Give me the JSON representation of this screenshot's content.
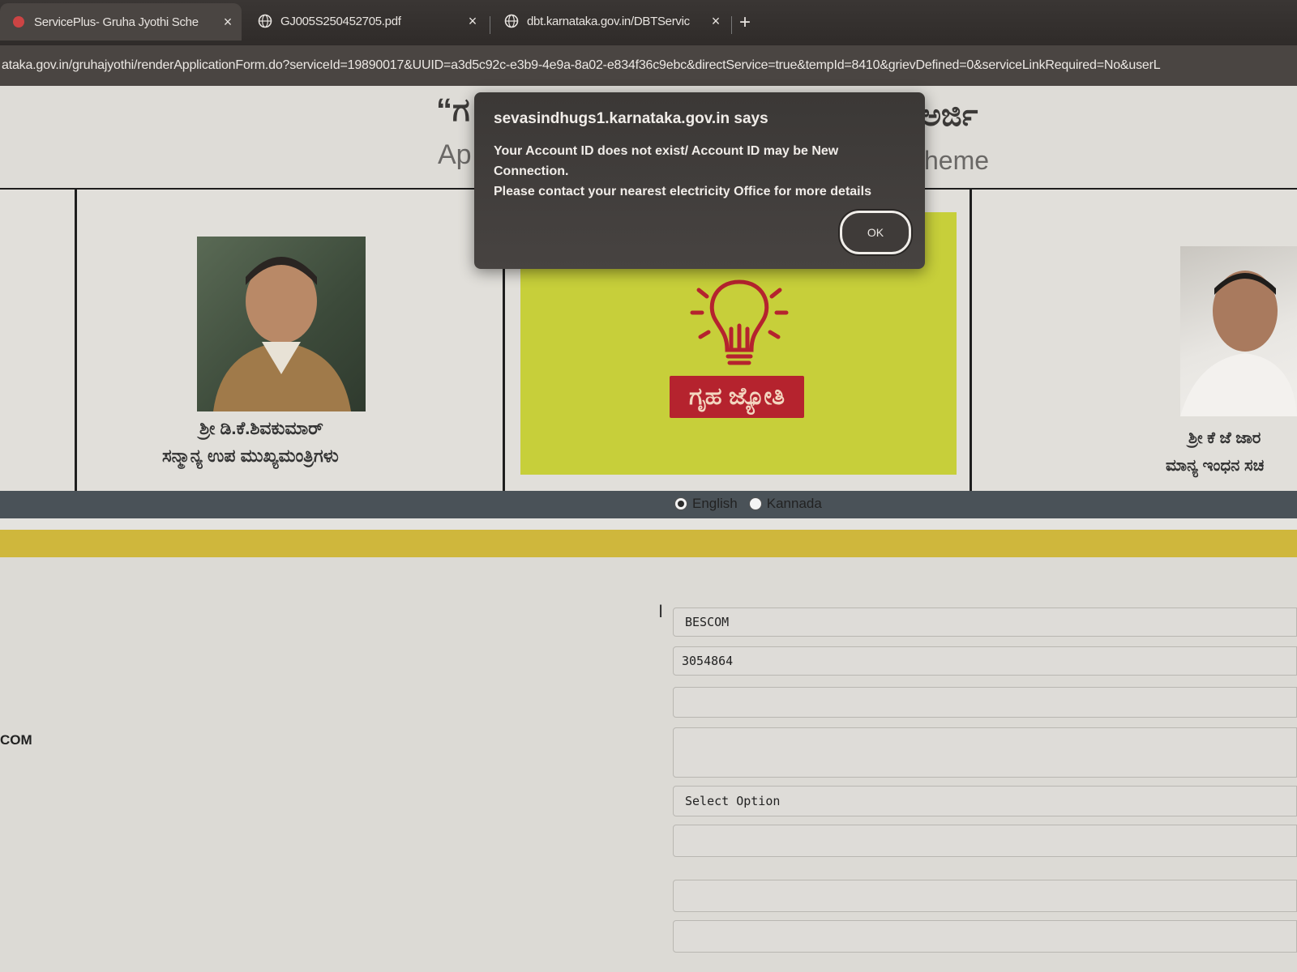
{
  "browser": {
    "tabs": [
      {
        "title": "ServicePlus- Gruha Jyothi Sche",
        "icon": "site-favicon"
      },
      {
        "title": "GJ005S250452705.pdf",
        "icon": "globe-icon"
      },
      {
        "title": "dbt.karnataka.gov.in/DBTServic",
        "icon": "globe-icon"
      }
    ],
    "close_glyph": "×",
    "new_tab_glyph": "+",
    "url": "ataka.gov.in/gruhajyothi/renderApplicationForm.do?serviceId=19890017&UUID=a3d5c92c-e3b9-4e9a-8a02-e834f36c9ebc&directService=true&tempId=8410&grievDefined=0&serviceLinkRequired=No&userL"
  },
  "header": {
    "quote_fragment": "“ಗ",
    "title_fragment_kn": "ಅರ್ಜಿ",
    "ap_fragment": "Ap",
    "scheme_fragment": "heme"
  },
  "banner": {
    "left_caption_line1": "ಶ್ರೀ ಡಿ.ಕೆ.ಶಿವಕುಮಾರ್",
    "left_caption_line2": "ಸನ್ಮಾನ್ಯ ಉಪ ಮುಖ್ಯಮಂತ್ರಿಗಳು",
    "logo_text": "ಗೃಹ ಜ್ಯೋತಿ",
    "right_caption_line1": "ಶ್ರೀ ಕೆ ಜೆ ಜಾರ",
    "right_caption_line2": "ಮಾನ್ಯ ಇಂಧನ ಸಚ"
  },
  "form": {
    "language_options": [
      "English",
      "Kannada"
    ],
    "selected_language": "English",
    "escom_value": "BESCOM",
    "account_id_value": "3054864",
    "select_placeholder": "Select Option",
    "side_label_fragment": "COM"
  },
  "dialog": {
    "origin": "sevasindhugs1.karnataka.gov.in says",
    "message_line1": "Your Account ID does not exist/ Account ID may be New Connection.",
    "message_line2": "Please contact your nearest electricity Office for more details",
    "ok_label": "OK"
  },
  "colors": {
    "logo_background": "#c7cf3a",
    "logo_label_background": "#b5232e",
    "accent_band": "#cfb73c",
    "dark_band": "#4a5258"
  }
}
